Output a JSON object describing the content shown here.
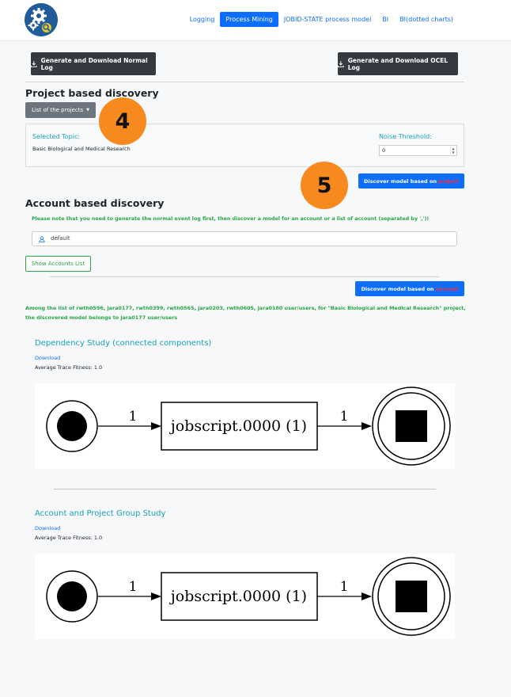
{
  "nav": {
    "items": [
      {
        "label": "Logging",
        "active": false
      },
      {
        "label": "Process Mining",
        "active": true
      },
      {
        "label": "JOBID-STATE process model",
        "active": false
      },
      {
        "label": "BI",
        "active": false
      },
      {
        "label": "BI(dotted charts)",
        "active": false
      }
    ]
  },
  "actions": {
    "normal_log_label": "Generate and Download Normal Log",
    "ocel_log_label": "Generate and Download OCEL Log"
  },
  "project_section": {
    "title": "Project based discovery",
    "dropdown_label": "List of the projects",
    "selected_topic_label": "Selected Topic:",
    "selected_topic_value": "Basic Biological and Medical Research",
    "noise_label": "Noise Threshold:",
    "noise_value": "0",
    "discover_prefix": "Discover model based on",
    "discover_highlight": "project"
  },
  "annotations": {
    "badge4": "4",
    "badge5": "5"
  },
  "account_section": {
    "title": "Account based discovery",
    "note": "Please note that you need to generate the normal event log first, then discover a model for an account or a list of account (separated by ',')!",
    "input_value": "default",
    "show_accounts_label": "Show Accounts List",
    "discover_prefix": "Discover model based on",
    "discover_highlight": "account",
    "result_line1": "Among the list of rwth0596, jara0177, rwth0399, rwth0565, jara0203, rwth0605, jara0180 user/users, for \"Basic Biological and Medical Research\" project,",
    "result_line2": "the discovered model belongs to jara0177 user/users"
  },
  "studies": [
    {
      "title": "Dependency Study (connected components)",
      "download": "Download",
      "fitness": "Average Trace Fitness: 1.0",
      "activity": "jobscript.0000 (1)",
      "edge_in": "1",
      "edge_out": "1"
    },
    {
      "title": "Account and Project Group Study",
      "download": "Download",
      "fitness": "Average Trace Fitness: 1.0",
      "activity": "jobscript.0000 (1)",
      "edge_in": "1",
      "edge_out": "1"
    }
  ],
  "colors": {
    "primary": "#0d6efd",
    "dark": "#343a40",
    "teal": "#17a2b8",
    "green": "#28a745",
    "badge_orange": "#f78a1f"
  }
}
